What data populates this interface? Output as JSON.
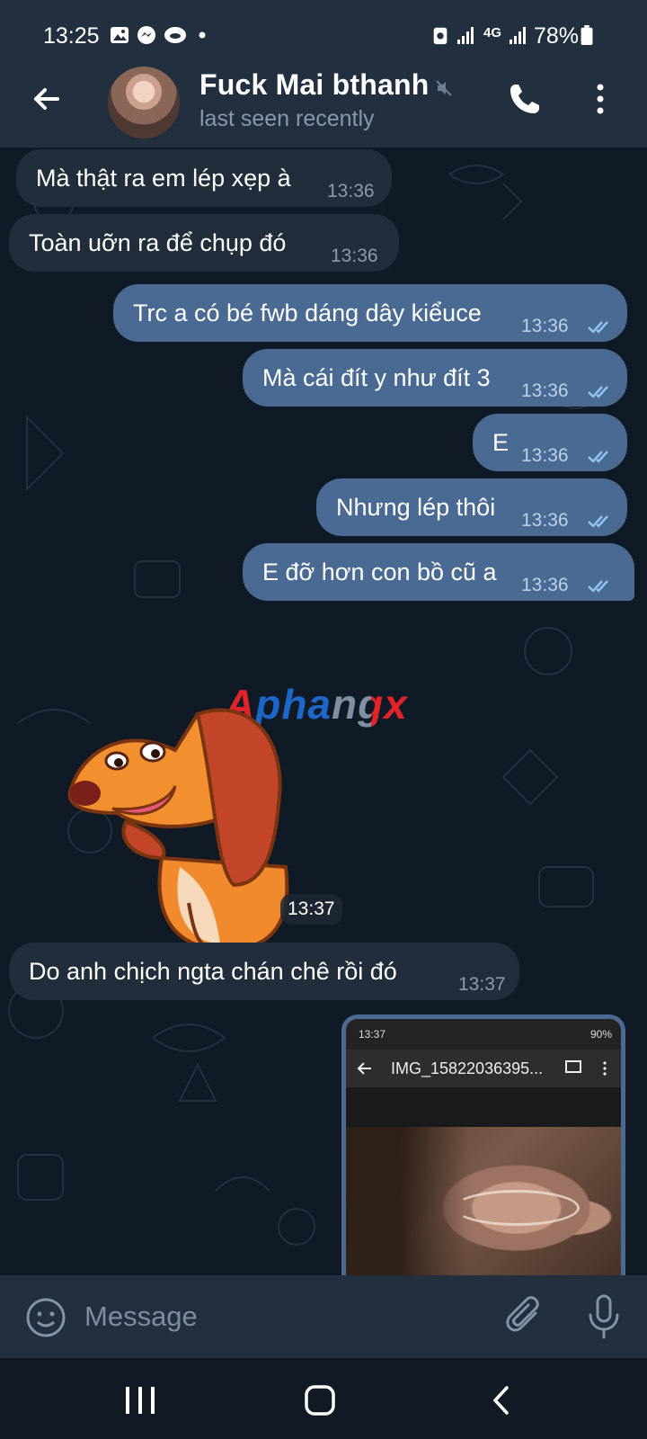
{
  "status_bar": {
    "time": "13:25",
    "battery": "78%",
    "network": "4G",
    "notification_icons": [
      "gallery-icon",
      "messenger-icon",
      "app-icon",
      "dot"
    ]
  },
  "header": {
    "title": "Fuck Mai bthanh",
    "subtitle": "last seen recently",
    "muted": true
  },
  "messages": [
    {
      "direction": "in",
      "text": "Mà thật ra em lép xẹp à",
      "time": "13:36"
    },
    {
      "direction": "in",
      "text": "Toàn uỡn ra để chụp đó",
      "time": "13:36"
    },
    {
      "direction": "out",
      "text": "Trc a có bé fwb dáng dây kiểuce",
      "time": "13:36",
      "read": true
    },
    {
      "direction": "out",
      "text": "Mà cái đít y như đít 3",
      "time": "13:36",
      "read": true
    },
    {
      "direction": "out",
      "text": "E",
      "time": "13:36",
      "read": true
    },
    {
      "direction": "out",
      "text": "Nhưng lép thôi",
      "time": "13:36",
      "read": true
    },
    {
      "direction": "out",
      "text": "E đỡ hơn con bồ cũ a",
      "time": "13:36",
      "read": true
    },
    {
      "direction": "in",
      "text": "Do anh chịch ngta chán chê rồi đó",
      "time": "13:37"
    }
  ],
  "sticker": {
    "time": "13:37",
    "icon": "dog-sticker"
  },
  "watermark": "Aphangx",
  "photo": {
    "status_time": "13:37",
    "status_battery": "90%",
    "file_name": "IMG_15822036395..."
  },
  "composer": {
    "placeholder": "Message"
  },
  "colors": {
    "header_bg": "#222f3e",
    "chat_bg": "#0f1a26",
    "incoming_bubble": "#212d3b",
    "outgoing_bubble": "#4a6a93",
    "read_ticks": "#8fc2ef"
  }
}
